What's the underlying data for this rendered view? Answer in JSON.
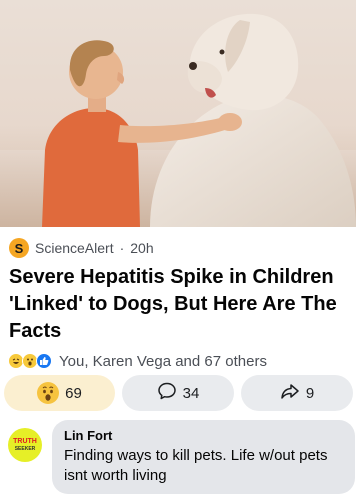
{
  "post": {
    "source_name": "ScienceAlert",
    "source_initial": "S",
    "separator": "·",
    "time": "20h",
    "headline": "Severe Hepatitis Spike in Children 'Linked' to Dogs, But Here Are The Facts",
    "image_icon": "boy-with-dog-photo"
  },
  "reactions": {
    "icons": [
      "haha-emoji-icon",
      "wow-emoji-icon",
      "like-thumb-icon"
    ],
    "summary": "You, Karen Vega and 67 others"
  },
  "actions": {
    "react_count": "69",
    "react_icon": "wow-emoji-icon",
    "comment_count": "34",
    "comment_icon": "comment-bubble-icon",
    "share_count": "9",
    "share_icon": "share-arrow-icon"
  },
  "comment": {
    "author": "Lin Fort",
    "text": "Finding ways to kill pets. Life w/out pets isnt worth living",
    "avatar_line1": "TRUTH",
    "avatar_line2": "SEEKER"
  },
  "colors": {
    "accent": "#1877f2",
    "source_logo": "#f5a623",
    "avatar_bg": "#e6ef27",
    "react_active_bg": "#fbefd0"
  }
}
